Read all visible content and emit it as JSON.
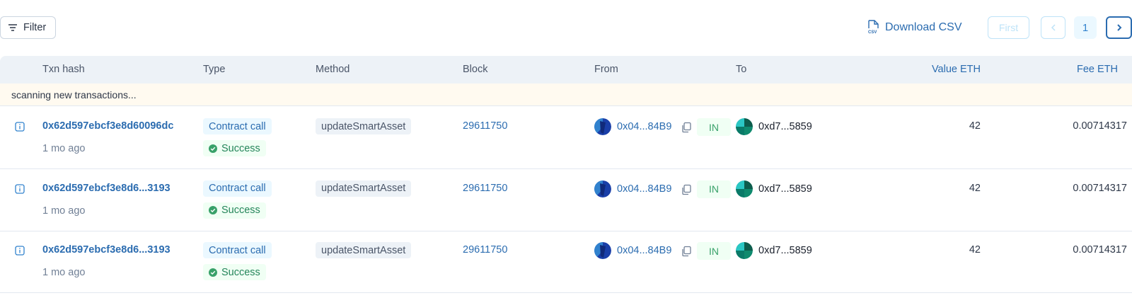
{
  "toolbar": {
    "filter_label": "Filter",
    "download_label": "Download CSV",
    "download_icon": "csv-file-icon"
  },
  "pagination": {
    "first_label": "First",
    "current_page": "1"
  },
  "table": {
    "headers": {
      "txn_hash": "Txn hash",
      "type": "Type",
      "method": "Method",
      "block": "Block",
      "from": "From",
      "to": "To",
      "value": "Value ETH",
      "fee": "Fee ETH"
    },
    "scanning_text": "scanning new transactions...",
    "rows": [
      {
        "hash": "0x62d597ebcf3e8d60096dc",
        "age": "1 mo ago",
        "type": "Contract call",
        "status": "Success",
        "method": "updateSmartAsset",
        "block": "29611750",
        "from": "0x04...84B9",
        "direction": "IN",
        "to": "0xd7...5859",
        "value": "42",
        "fee": "0.00714317"
      },
      {
        "hash": "0x62d597ebcf3e8d6...3193",
        "age": "1 mo ago",
        "type": "Contract call",
        "status": "Success",
        "method": "updateSmartAsset",
        "block": "29611750",
        "from": "0x04...84B9",
        "direction": "IN",
        "to": "0xd7...5859",
        "value": "42",
        "fee": "0.00714317"
      },
      {
        "hash": "0x62d597ebcf3e8d6...3193",
        "age": "1 mo ago",
        "type": "Contract call",
        "status": "Success",
        "method": "updateSmartAsset",
        "block": "29611750",
        "from": "0x04...84B9",
        "direction": "IN",
        "to": "0xd7...5859",
        "value": "42",
        "fee": "0.00714317"
      }
    ]
  },
  "colors": {
    "link": "#2b6cb0",
    "success": "#38a169",
    "header_bg": "#edf2f7",
    "scanning_bg": "#fffaf0"
  }
}
